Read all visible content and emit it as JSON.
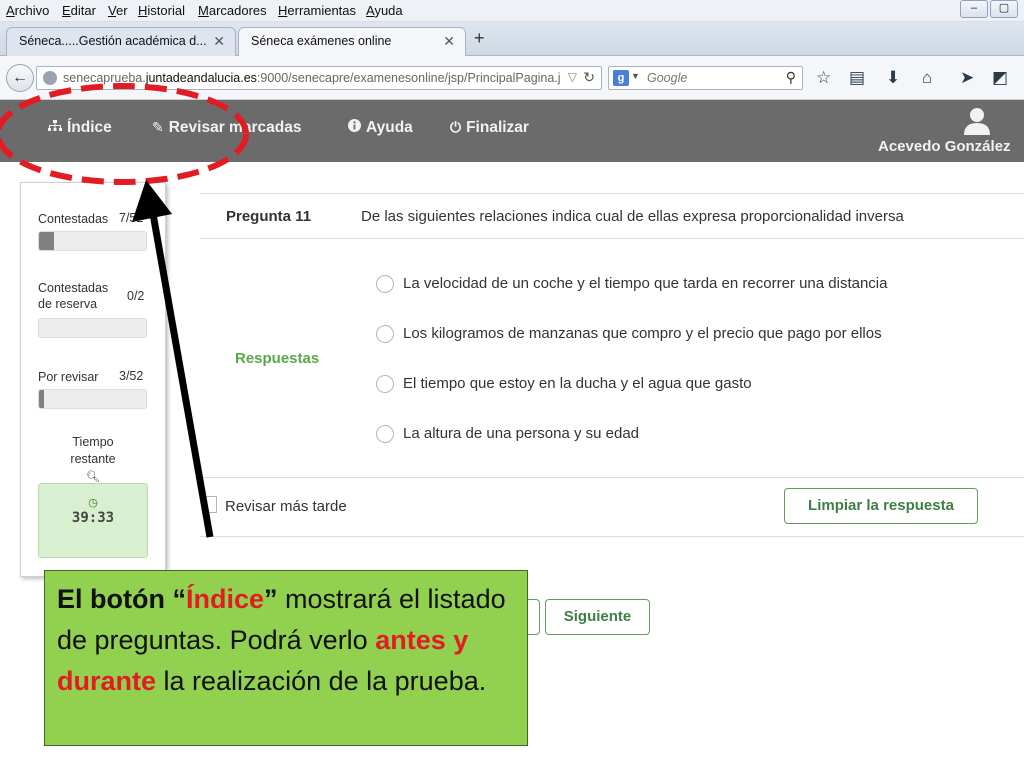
{
  "browser": {
    "menu": [
      "Archivo",
      "Editar",
      "Ver",
      "Historial",
      "Marcadores",
      "Herramientas",
      "Ayuda"
    ],
    "tabs": [
      {
        "label": "Séneca.....Gestión académica d...",
        "active": false
      },
      {
        "label": "Séneca exámenes online",
        "active": true
      }
    ],
    "url": {
      "prefix": "senecaprueba.",
      "host": "juntadeandalucia.es",
      "rest": ":9000/senecapre/examenesonline/jsp/PrincipalPagina.j"
    },
    "search_placeholder": "Google",
    "search_engine_letter": "g"
  },
  "app_nav": {
    "items": [
      {
        "label": "Índice",
        "icon": "sitemap-icon"
      },
      {
        "label": "Revisar marcadas",
        "icon": "pencil-icon"
      },
      {
        "label": "Ayuda",
        "icon": "info-icon"
      },
      {
        "label": "Finalizar",
        "icon": "power-icon"
      }
    ],
    "user_name": "Acevedo González"
  },
  "side_panel": {
    "answered": {
      "label": "Contestadas",
      "count": "7/52",
      "progress": 0.14
    },
    "reserve": {
      "label_line1": "Contestadas",
      "label_line2": "de reserva",
      "count": "0/2",
      "progress": 0
    },
    "review": {
      "label": "Por revisar",
      "count": "3/52",
      "progress": 0.05
    },
    "timer": {
      "label_line1": "Tiempo",
      "label_line2": "restante",
      "value": "39:33"
    }
  },
  "question": {
    "number_label": "Pregunta 11",
    "text": "De las siguientes relaciones indica cual de ellas expresa proporcionalidad inversa",
    "answers_label": "Respuestas",
    "options": [
      "La velocidad de un coche y el tiempo que tarda en recorrer una distancia",
      "Los kilogramos de manzanas que compro y el precio que pago por ellos",
      "El tiempo que estoy en la ducha y el agua que gasto",
      "La altura de una persona y su edad"
    ],
    "review_later_label": "Revisar más tarde",
    "clear_button": "Limpiar la respuesta",
    "next_button": "Siguiente"
  },
  "annotation": {
    "part1": "El botón “",
    "highlight1": "Índice",
    "part2": "” mostrará el listado de preguntas. Podrá verlo ",
    "highlight2": "antes y durante",
    "part3": " la realización de la prueba.",
    "accent_color": "#e31b23",
    "box_color": "#92d050"
  }
}
